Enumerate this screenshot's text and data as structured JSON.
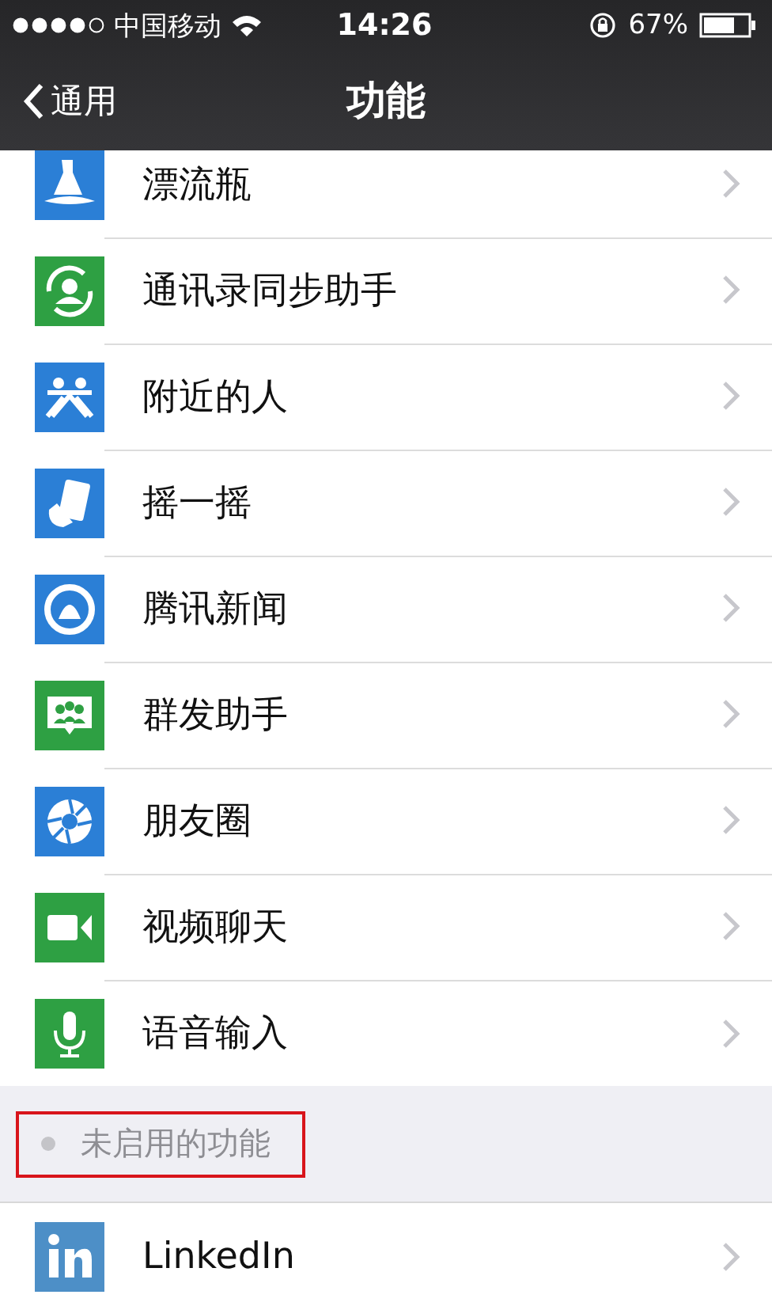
{
  "status_bar": {
    "carrier": "中国移动",
    "time": "14:26",
    "battery": "67%"
  },
  "nav_bar": {
    "back": "通用",
    "title": "功能"
  },
  "enabled_items": [
    {
      "label": "漂流瓶",
      "color": "#2b7fd6"
    },
    {
      "label": "通讯录同步助手",
      "color": "#2ea043"
    },
    {
      "label": "附近的人",
      "color": "#2b7fd6"
    },
    {
      "label": "摇一摇",
      "color": "#2b7fd6"
    },
    {
      "label": "腾讯新闻",
      "color": "#2b7fd6"
    },
    {
      "label": "群发助手",
      "color": "#2ea043"
    },
    {
      "label": "朋友圈",
      "color": "#2b7fd6"
    },
    {
      "label": "视频聊天",
      "color": "#2ea043"
    },
    {
      "label": "语音输入",
      "color": "#2ea043"
    }
  ],
  "disabled_section": {
    "title": "未启用的功能",
    "highlighted": true,
    "items": [
      {
        "label": "LinkedIn",
        "color": "#4d8fc7"
      }
    ]
  }
}
